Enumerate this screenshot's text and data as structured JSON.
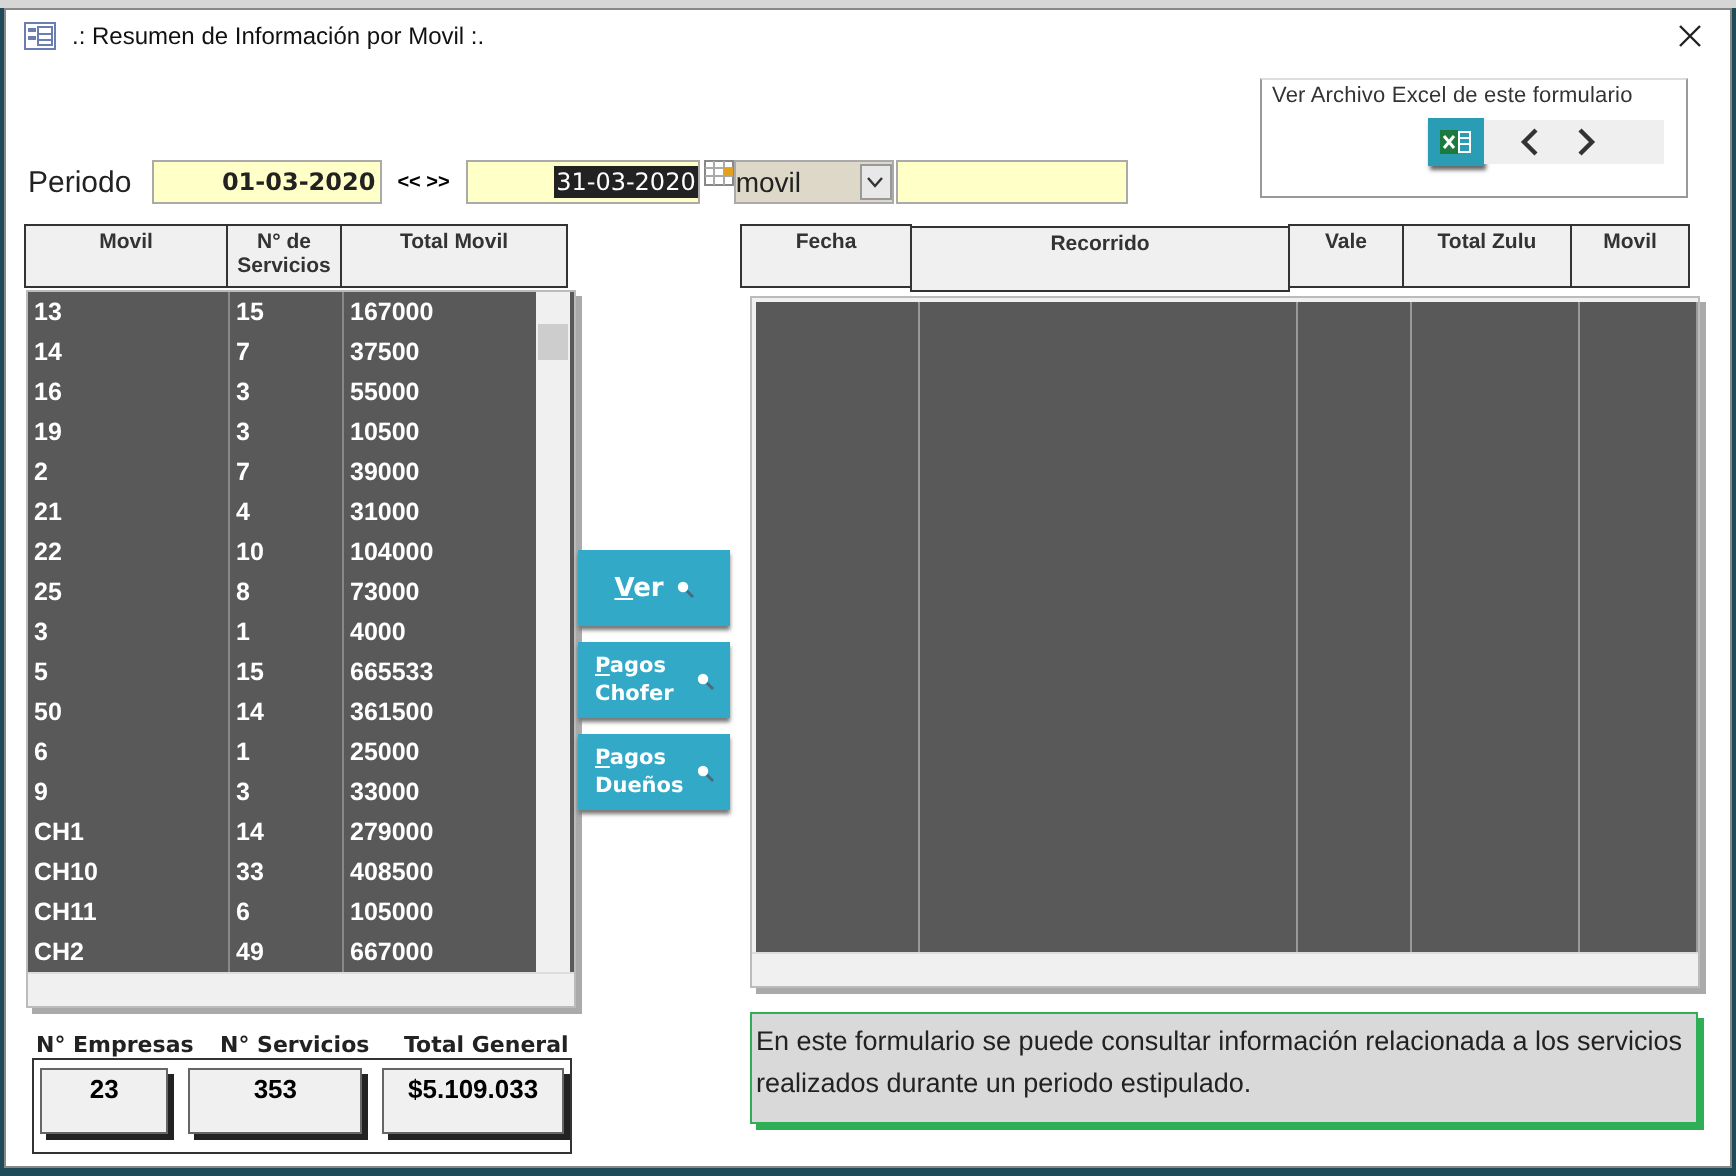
{
  "window": {
    "title": ".: Resumen de Información por Movil :."
  },
  "excel_panel": {
    "label": "Ver Archivo Excel de este formulario"
  },
  "period": {
    "label": "Periodo",
    "from": "01-03-2020",
    "separator": "<< >>",
    "to": "31-03-2020",
    "group_by": "movil"
  },
  "summary_table": {
    "columns": [
      "Movil",
      "N° de Servicios",
      "Total Movil"
    ],
    "rows": [
      [
        "13",
        "15",
        "167000"
      ],
      [
        "14",
        "7",
        "37500"
      ],
      [
        "16",
        "3",
        "55000"
      ],
      [
        "19",
        "3",
        "10500"
      ],
      [
        "2",
        "7",
        "39000"
      ],
      [
        "21",
        "4",
        "31000"
      ],
      [
        "22",
        "10",
        "104000"
      ],
      [
        "25",
        "8",
        "73000"
      ],
      [
        "3",
        "1",
        "4000"
      ],
      [
        "5",
        "15",
        "665533"
      ],
      [
        "50",
        "14",
        "361500"
      ],
      [
        "6",
        "1",
        "25000"
      ],
      [
        "9",
        "3",
        "33000"
      ],
      [
        "CH1",
        "14",
        "279000"
      ],
      [
        "CH10",
        "33",
        "408500"
      ],
      [
        "CH11",
        "6",
        "105000"
      ],
      [
        "CH2",
        "49",
        "667000"
      ]
    ]
  },
  "buttons": [
    {
      "kind": "single",
      "label": "Ver"
    },
    {
      "kind": "double",
      "label": "Pagos Chofer"
    },
    {
      "kind": "double",
      "label": "Pagos Dueños"
    }
  ],
  "detail_table": {
    "columns": [
      "Fecha",
      "Recorrido",
      "Vale",
      "Total Zulu",
      "Movil"
    ]
  },
  "totals": [
    {
      "label": "N° Empresas",
      "value": "23"
    },
    {
      "label": "N° Servicios",
      "value": "353"
    },
    {
      "label": "Total General",
      "value": "$5.109.033"
    }
  ],
  "info": "En este formulario se puede consultar información relacionada a los servicios realizados durante un periodo estipulado."
}
